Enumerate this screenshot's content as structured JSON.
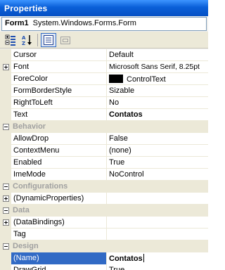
{
  "window": {
    "title": "Properties"
  },
  "object_selector": {
    "name": "Form1",
    "type": "System.Windows.Forms.Form"
  },
  "toolbar": {
    "buttons": [
      {
        "name": "categorized",
        "icon": "categorized-icon",
        "active": false
      },
      {
        "name": "alphabetical",
        "icon": "alphabetical-icon",
        "active": false
      },
      {
        "name": "properties",
        "icon": "properties-icon",
        "active": true
      },
      {
        "name": "property-pages",
        "icon": "property-pages-icon",
        "active": false
      }
    ]
  },
  "grid": {
    "rows": [
      {
        "kind": "prop",
        "name": "Cursor",
        "value": "Default"
      },
      {
        "kind": "prop",
        "name": "Font",
        "value": "Microsoft Sans Serif, 8.25pt",
        "expander": "plus"
      },
      {
        "kind": "prop",
        "name": "ForeColor",
        "value": "ControlText",
        "swatch": "#000000"
      },
      {
        "kind": "prop",
        "name": "FormBorderStyle",
        "value": "Sizable"
      },
      {
        "kind": "prop",
        "name": "RightToLeft",
        "value": "No"
      },
      {
        "kind": "prop",
        "name": "Text",
        "value": "Contatos",
        "bold": true
      },
      {
        "kind": "category",
        "name": "Behavior"
      },
      {
        "kind": "prop",
        "name": "AllowDrop",
        "value": "False"
      },
      {
        "kind": "prop",
        "name": "ContextMenu",
        "value": "(none)"
      },
      {
        "kind": "prop",
        "name": "Enabled",
        "value": "True"
      },
      {
        "kind": "prop",
        "name": "ImeMode",
        "value": "NoControl"
      },
      {
        "kind": "category",
        "name": "Configurations"
      },
      {
        "kind": "prop",
        "name": "(DynamicProperties)",
        "value": "",
        "expander": "plus"
      },
      {
        "kind": "category",
        "name": "Data"
      },
      {
        "kind": "prop",
        "name": "(DataBindings)",
        "value": "",
        "expander": "plus"
      },
      {
        "kind": "prop",
        "name": "Tag",
        "value": ""
      },
      {
        "kind": "category",
        "name": "Design"
      },
      {
        "kind": "prop",
        "name": "(Name)",
        "value": "Contatos",
        "bold": true,
        "selected": true
      },
      {
        "kind": "prop",
        "name": "DrawGrid",
        "value": "True"
      }
    ]
  }
}
